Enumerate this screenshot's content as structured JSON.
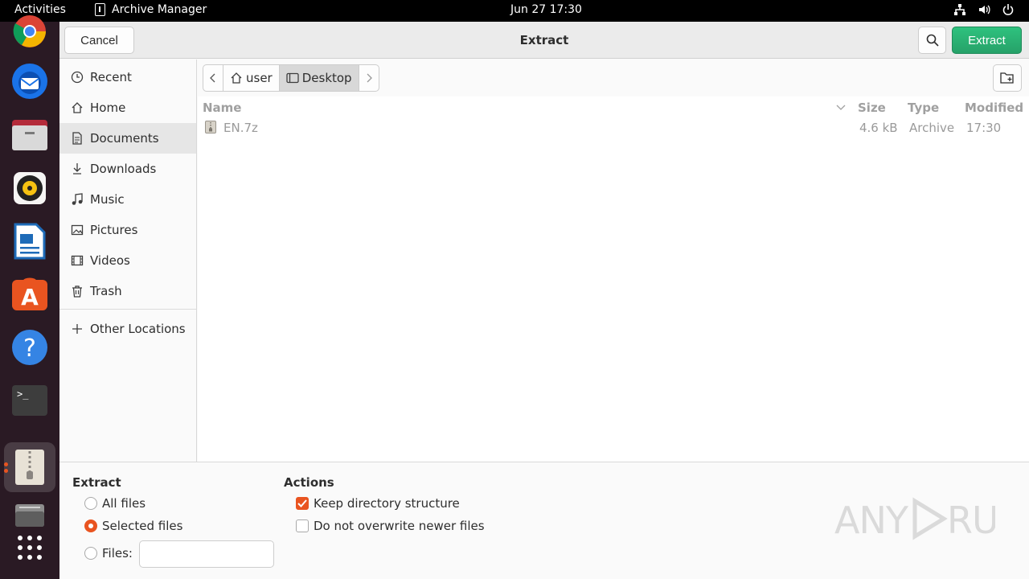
{
  "topbar": {
    "activities": "Activities",
    "app_name": "Archive Manager",
    "clock": "Jun 27  17:30"
  },
  "dock": {
    "items": [
      "chrome-icon",
      "thunderbird-icon",
      "files-icon",
      "rhythmbox-icon",
      "writer-icon",
      "app-center-icon",
      "help-icon",
      "terminal-icon",
      "archive-manager-icon",
      "drive-icon",
      "app-grid-icon"
    ]
  },
  "header": {
    "title": "Extract",
    "cancel_label": "Cancel",
    "extract_label": "Extract"
  },
  "sidebar": {
    "items": [
      {
        "label": "Recent",
        "icon": "clock-icon"
      },
      {
        "label": "Home",
        "icon": "home-icon"
      },
      {
        "label": "Documents",
        "icon": "document-icon"
      },
      {
        "label": "Downloads",
        "icon": "download-icon"
      },
      {
        "label": "Music",
        "icon": "music-icon"
      },
      {
        "label": "Pictures",
        "icon": "picture-icon"
      },
      {
        "label": "Videos",
        "icon": "video-icon"
      },
      {
        "label": "Trash",
        "icon": "trash-icon"
      }
    ],
    "other_locations": "Other Locations"
  },
  "pathbar": {
    "segments": [
      "user",
      "Desktop"
    ]
  },
  "filelist": {
    "columns": {
      "name": "Name",
      "size": "Size",
      "type": "Type",
      "modified": "Modified"
    },
    "rows": [
      {
        "name": "EN.7z",
        "size": "4.6 kB",
        "type": "Archive",
        "modified": "17:30"
      }
    ]
  },
  "options": {
    "extract_heading": "Extract",
    "all_files": "All files",
    "selected_files": "Selected files",
    "files_label": "Files:",
    "files_value": "",
    "actions_heading": "Actions",
    "keep_structure": "Keep directory structure",
    "no_overwrite": "Do not overwrite newer files"
  },
  "watermark": "ANY RUN",
  "colors": {
    "accent": "#e95420",
    "extract_button": "#26a269"
  }
}
